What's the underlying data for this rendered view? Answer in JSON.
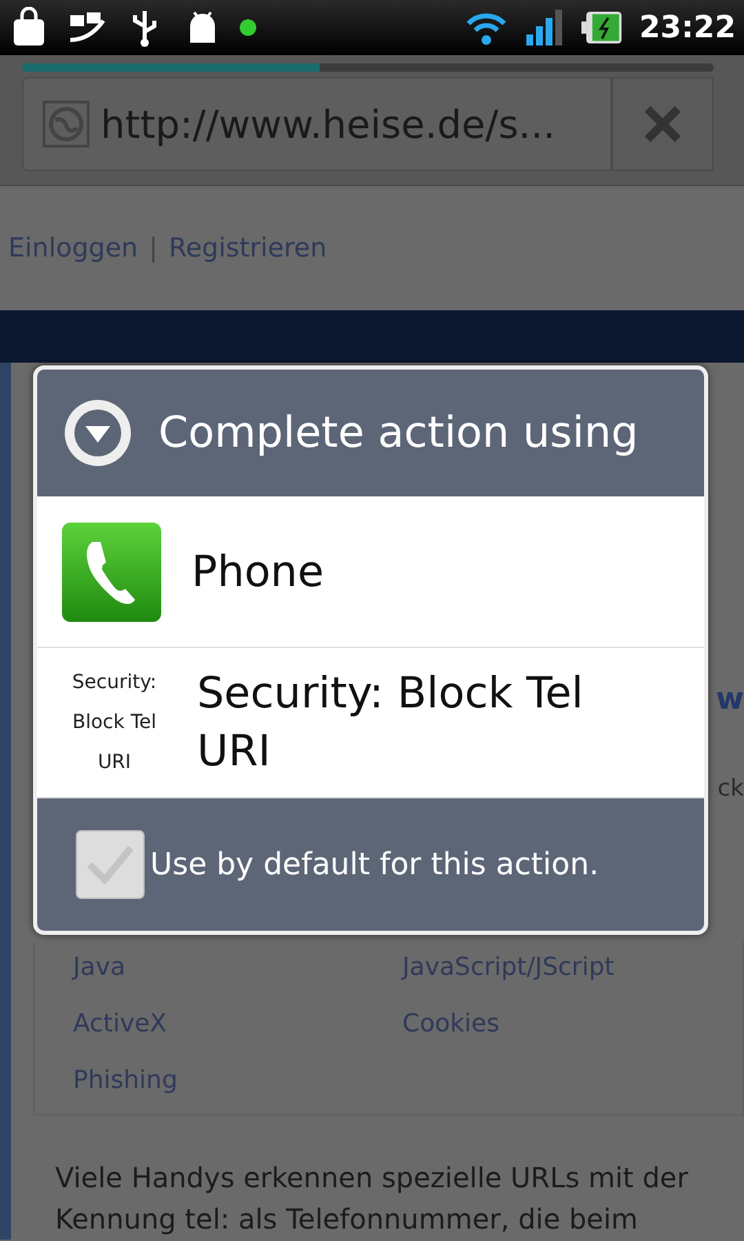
{
  "status_bar": {
    "time": "23:22"
  },
  "browser": {
    "url": "http://www.heise.de/s...",
    "progress": {
      "level": 0.43
    }
  },
  "page": {
    "account_links": [
      "Einloggen",
      "Registrieren"
    ],
    "account_separator": "|",
    "fragments": [
      "w",
      "ck"
    ],
    "topic_links": [
      "Java",
      "JavaScript/JScript",
      "ActiveX",
      "Cookies",
      "Phishing"
    ],
    "paragraph_lines": [
      "Viele Handys erkennen spezielle URLs mit der",
      "Kennung tel: als Telefonnummer, die beim"
    ]
  },
  "dialog": {
    "title": "Complete action using",
    "options": [
      {
        "kind": "app-icon",
        "name": "Phone"
      },
      {
        "kind": "text-icon",
        "icon_label": "Security: Block Tel URI",
        "name": "Security: Block Tel URI"
      }
    ],
    "default_checkbox": {
      "label": "Use by default for this action.",
      "checked": false
    }
  }
}
